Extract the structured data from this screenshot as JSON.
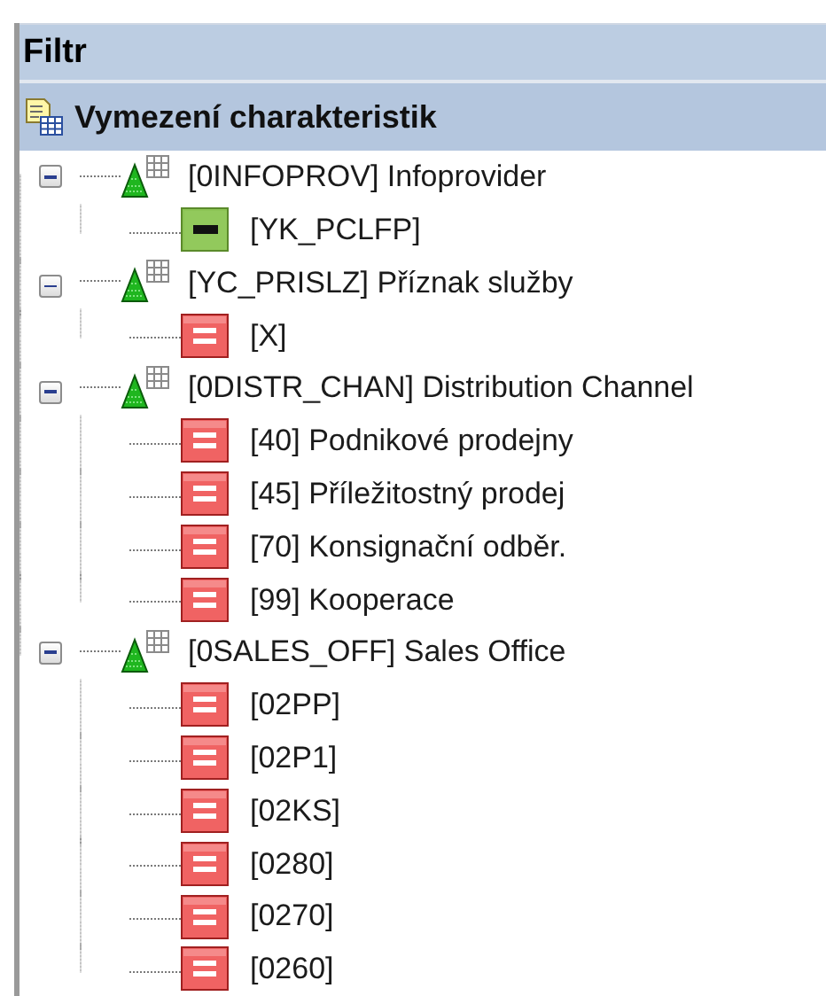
{
  "panel": {
    "title": "Filtr"
  },
  "section": {
    "title": "Vymezení charakteristik"
  },
  "tree": [
    {
      "label": "[0INFOPROV] Infoprovider",
      "expanded": true,
      "children": [
        {
          "label": "[YK_PCLFP]",
          "kind": "fixed"
        }
      ]
    },
    {
      "label": "[YC_PRISLZ] Příznak služby",
      "expanded": true,
      "children": [
        {
          "label": "[X]",
          "kind": "value"
        }
      ]
    },
    {
      "label": "[0DISTR_CHAN] Distribution Channel",
      "expanded": true,
      "children": [
        {
          "label": "[40] Podnikové prodejny",
          "kind": "value"
        },
        {
          "label": "[45] Příležitostný prodej",
          "kind": "value"
        },
        {
          "label": "[70] Konsignační odběr.",
          "kind": "value"
        },
        {
          "label": "[99] Kooperace",
          "kind": "value"
        }
      ]
    },
    {
      "label": "[0SALES_OFF] Sales Office",
      "expanded": true,
      "children": [
        {
          "label": "[02PP]",
          "kind": "value"
        },
        {
          "label": "[02P1]",
          "kind": "value"
        },
        {
          "label": "[02KS]",
          "kind": "value"
        },
        {
          "label": "[0280]",
          "kind": "value"
        },
        {
          "label": "[0270]",
          "kind": "value"
        },
        {
          "label": "[0260]",
          "kind": "value"
        }
      ]
    }
  ]
}
